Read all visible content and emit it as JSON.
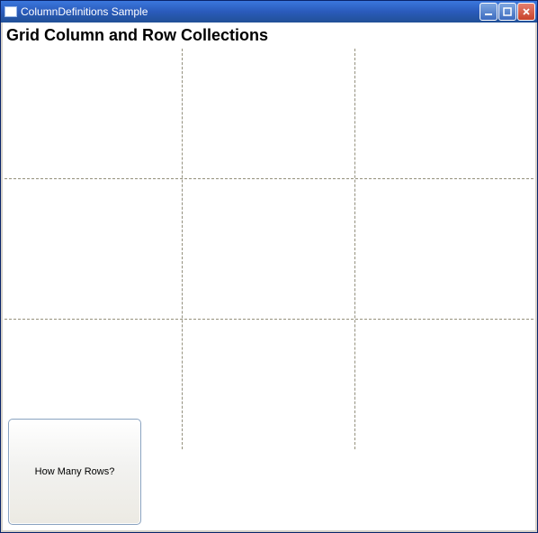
{
  "window": {
    "title": "ColumnDefinitions Sample"
  },
  "heading": "Grid Column and Row Collections",
  "grid": {
    "columns": 3,
    "rows": 3
  },
  "button": {
    "label": "How Many Rows?"
  },
  "icons": {
    "app": "app-window-icon",
    "min": "minimize-icon",
    "max": "maximize-icon",
    "close": "close-icon"
  }
}
